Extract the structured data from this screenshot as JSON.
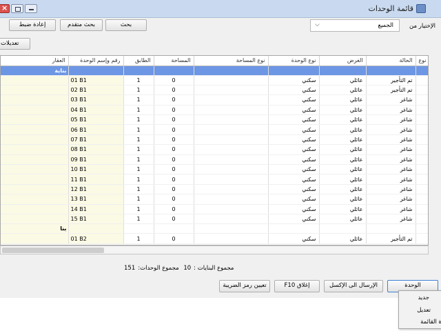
{
  "window": {
    "title": "قائمة الوحدات"
  },
  "toolbar": {
    "filter_label": "الإختيار من",
    "filter_value": "الجميع",
    "search_button": "بحث",
    "advanced_search_button": "بحث متقدم",
    "reset_button": "إعادة ضبط",
    "edits_button": "تعديلات"
  },
  "table": {
    "headers": {
      "property": "العقار",
      "unit": "رقم وإسم الوحدة",
      "floor": "الطابق",
      "area": "المساحة",
      "area_type": "نوع المساحة",
      "unit_type": "نوع الوحدة",
      "purpose": "الغرض",
      "status": "الحالة",
      "extra": "نوع"
    },
    "group_label": "بناية",
    "group2_label": "بنا",
    "rows": [
      {
        "unit": "01 B1",
        "floor": "1",
        "area": "0",
        "unit_type": "سكني",
        "purpose": "عائلي",
        "status": "تم التأجير"
      },
      {
        "unit": "02 B1",
        "floor": "1",
        "area": "0",
        "unit_type": "سكني",
        "purpose": "عائلي",
        "status": "تم التأجير"
      },
      {
        "unit": "03 B1",
        "floor": "1",
        "area": "0",
        "unit_type": "سكني",
        "purpose": "عائلي",
        "status": "شاغر"
      },
      {
        "unit": "04 B1",
        "floor": "1",
        "area": "0",
        "unit_type": "سكني",
        "purpose": "عائلي",
        "status": "شاغر"
      },
      {
        "unit": "05 B1",
        "floor": "1",
        "area": "0",
        "unit_type": "سكني",
        "purpose": "عائلي",
        "status": "شاغر"
      },
      {
        "unit": "06 B1",
        "floor": "1",
        "area": "0",
        "unit_type": "سكني",
        "purpose": "عائلي",
        "status": "شاغر"
      },
      {
        "unit": "07 B1",
        "floor": "1",
        "area": "0",
        "unit_type": "سكني",
        "purpose": "عائلي",
        "status": "شاغر"
      },
      {
        "unit": "08 B1",
        "floor": "1",
        "area": "0",
        "unit_type": "سكني",
        "purpose": "عائلي",
        "status": "شاغر"
      },
      {
        "unit": "09 B1",
        "floor": "1",
        "area": "0",
        "unit_type": "سكني",
        "purpose": "عائلي",
        "status": "شاغر"
      },
      {
        "unit": "10 B1",
        "floor": "1",
        "area": "0",
        "unit_type": "سكني",
        "purpose": "عائلي",
        "status": "شاغر"
      },
      {
        "unit": "11 B1",
        "floor": "1",
        "area": "0",
        "unit_type": "سكني",
        "purpose": "عائلي",
        "status": "شاغر"
      },
      {
        "unit": "12 B1",
        "floor": "1",
        "area": "0",
        "unit_type": "سكني",
        "purpose": "عائلي",
        "status": "شاغر"
      },
      {
        "unit": "13 B1",
        "floor": "1",
        "area": "0",
        "unit_type": "سكني",
        "purpose": "عائلي",
        "status": "شاغر"
      },
      {
        "unit": "14 B1",
        "floor": "1",
        "area": "0",
        "unit_type": "سكني",
        "purpose": "عائلي",
        "status": "شاغر"
      },
      {
        "unit": "15 B1",
        "floor": "1",
        "area": "0",
        "unit_type": "سكني",
        "purpose": "عائلي",
        "status": "شاغر"
      }
    ],
    "last_row": {
      "unit": "01 B2",
      "floor": "1",
      "area": "0",
      "unit_type": "سكني",
      "purpose": "عائلي",
      "status": "تم التأجير"
    }
  },
  "summary": {
    "buildings_label": "مجموع البنايات :",
    "buildings_count": "10",
    "units_label": "مجموع الوحدات:",
    "units_count": "151"
  },
  "buttons": {
    "unit": "الوحدة",
    "export_excel": "الإرسال الى الإكسل",
    "close": "إغلاق F10",
    "tax_code": "تعيين رمز الضريبة"
  },
  "context_menu": {
    "items": [
      "جديد",
      "تعديل",
      "ة القائمة"
    ]
  },
  "colors": {
    "selected_row": "#6d96e4",
    "highlight_column": "#fbfae5",
    "titlebar": "#c9daf0"
  }
}
